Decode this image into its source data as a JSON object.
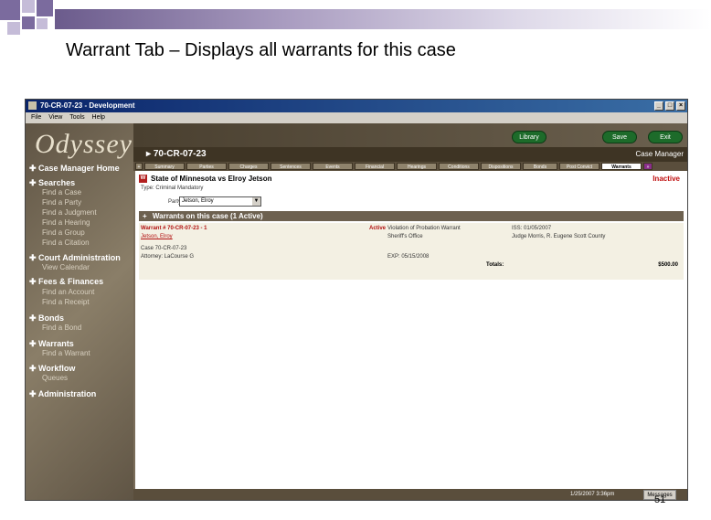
{
  "slide": {
    "title": "Warrant Tab – Displays all warrants for this case",
    "page_number": "51",
    "colors": {
      "square_dark": "#7b6b9e",
      "square_light": "#c5bcd8",
      "bar_start": "#6b5b8c",
      "bar_end": "#ffffff"
    }
  },
  "window": {
    "title": "70-CR-07-23 - Development",
    "menu": [
      "File",
      "View",
      "Tools",
      "Help"
    ],
    "controls": {
      "minimize": "_",
      "maximize": "□",
      "close": "×"
    }
  },
  "app": {
    "logo": "Odyssey",
    "toolbar": {
      "button_1": "Library",
      "button_2": "Save",
      "button_3": "Exit"
    },
    "case_number": "70-CR-07-23",
    "case_manager_label": "Case Manager",
    "tabs": [
      "Summary",
      "Parties",
      "Charges",
      "Sentences",
      "Events",
      "Financial",
      "Hearings",
      "Conditions",
      "Dispositions",
      "Bonds",
      "Post Convict",
      "Warrants"
    ],
    "active_tab": "Warrants",
    "tab_more": "»",
    "footer": {
      "time": "1/25/2007 3:36pm",
      "messages": "Messages"
    }
  },
  "sidebar": {
    "sections": [
      {
        "header": "Case Manager Home",
        "items": []
      },
      {
        "header": "Searches",
        "items": [
          "Find a Case",
          "Find a Party",
          "Find a Judgment",
          "Find a Hearing",
          "Find a Group",
          "Find a Citation"
        ]
      },
      {
        "header": "Court Administration",
        "items": [
          "View Calendar"
        ]
      },
      {
        "header": "Fees & Finances",
        "items": [
          "Find an Account",
          "Find a Receipt"
        ]
      },
      {
        "header": "Bonds",
        "items": [
          "Find a Bond"
        ]
      },
      {
        "header": "Warrants",
        "items": [
          "Find a Warrant"
        ]
      },
      {
        "header": "Workflow",
        "items": [
          "Queues"
        ]
      },
      {
        "header": "Administration",
        "items": []
      }
    ]
  },
  "content": {
    "brand_icon": "W",
    "case_title": "State of Minnesota vs Elroy Jetson",
    "status": "Inactive",
    "type_text": "Type: Criminal Mandatory",
    "party_label": "Party",
    "party_select": "Jetson, Elroy",
    "section_title": "Warrants on this case (1 Active)",
    "section_plus": "+",
    "warrant": {
      "id": "Warrant # 70-CR-07-23 - 1",
      "party_link": "Jetson, Elroy",
      "case_line": "Case 70-CR-07-23",
      "assigned_line": "Attorney: LaCourse G",
      "status_label": "Active",
      "reason": "Violation of Probation Warrant",
      "officer": "Sheriff's Office",
      "issued": "ISS: 01/05/2007",
      "judge": "Judge Morris, R. Eugene Scott County",
      "expiry": "EXP: 05/15/2008",
      "totals_label": "Totals:",
      "totals_value": "$500.00"
    }
  }
}
